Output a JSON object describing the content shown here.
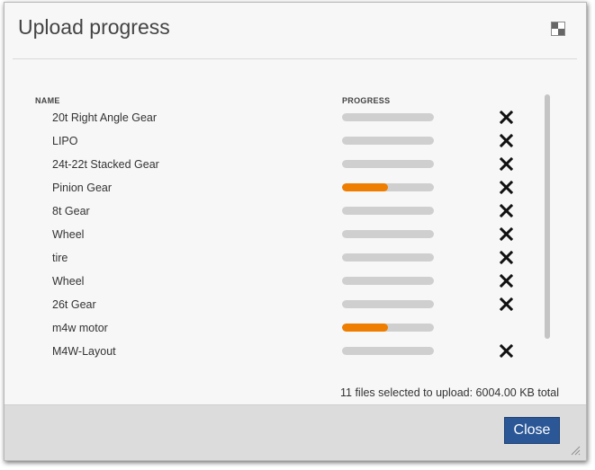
{
  "dialog": {
    "title": "Upload progress",
    "maximize_icon": "maximize-icon"
  },
  "columns": {
    "name": "NAME",
    "progress": "PROGRESS"
  },
  "files": [
    {
      "name": "20t Right Angle Gear",
      "progress": 0,
      "removable": true
    },
    {
      "name": "LIPO",
      "progress": 0,
      "removable": true
    },
    {
      "name": "24t-22t Stacked Gear",
      "progress": 0,
      "removable": true
    },
    {
      "name": "Pinion Gear",
      "progress": 0.5,
      "removable": true
    },
    {
      "name": "8t Gear",
      "progress": 0,
      "removable": true
    },
    {
      "name": "Wheel",
      "progress": 0,
      "removable": true
    },
    {
      "name": "tire",
      "progress": 0,
      "removable": true
    },
    {
      "name": "Wheel",
      "progress": 0,
      "removable": true
    },
    {
      "name": "26t Gear",
      "progress": 0,
      "removable": true
    },
    {
      "name": "m4w motor",
      "progress": 0.5,
      "removable": false
    },
    {
      "name": "M4W-Layout",
      "progress": 0,
      "removable": true
    }
  ],
  "summary": "11 files selected to upload: 6004.00 KB total",
  "footer": {
    "close_label": "Close"
  },
  "colors": {
    "progress_fill": "#ef7d00",
    "progress_track": "#cfcfcf",
    "close_button": "#2b5797"
  }
}
